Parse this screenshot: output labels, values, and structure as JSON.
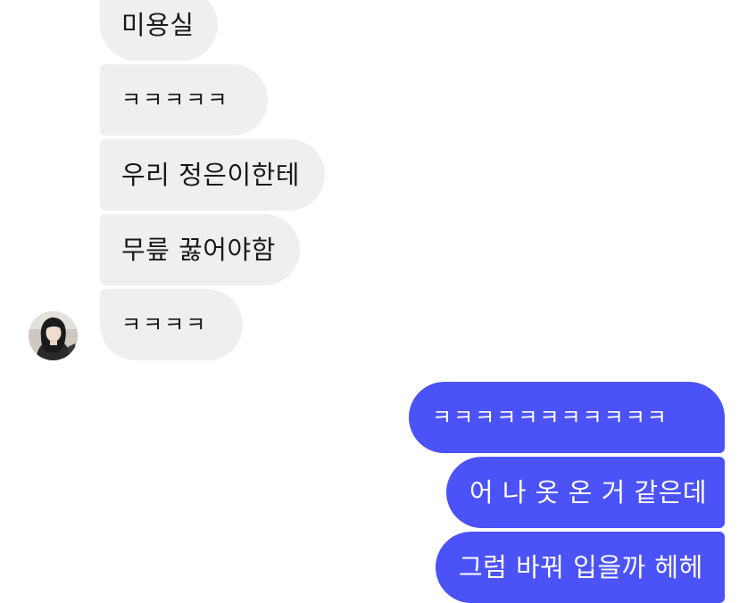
{
  "incoming": [
    {
      "text": "미용실"
    },
    {
      "text": "ㅋㅋㅋㅋㅋ"
    },
    {
      "text": "우리 정은이한테"
    },
    {
      "text": "무릎 꿇어야함"
    },
    {
      "text": "ㅋㅋㅋㅋ"
    }
  ],
  "outgoing": [
    {
      "text": "ㅋㅋㅋㅋㅋㅋㅋㅋㅋㅋㅋ"
    },
    {
      "text": "어 나 옷 온 거 같은데"
    },
    {
      "text": "그럼 바꿔 입을까 헤헤"
    }
  ],
  "colors": {
    "incoming_bubble": "#efefef",
    "outgoing_bubble": "#4b52f7",
    "outgoing_text": "#ffffff",
    "incoming_text": "#1a1a1a"
  },
  "icons": {
    "contact_avatar": "avatar"
  }
}
